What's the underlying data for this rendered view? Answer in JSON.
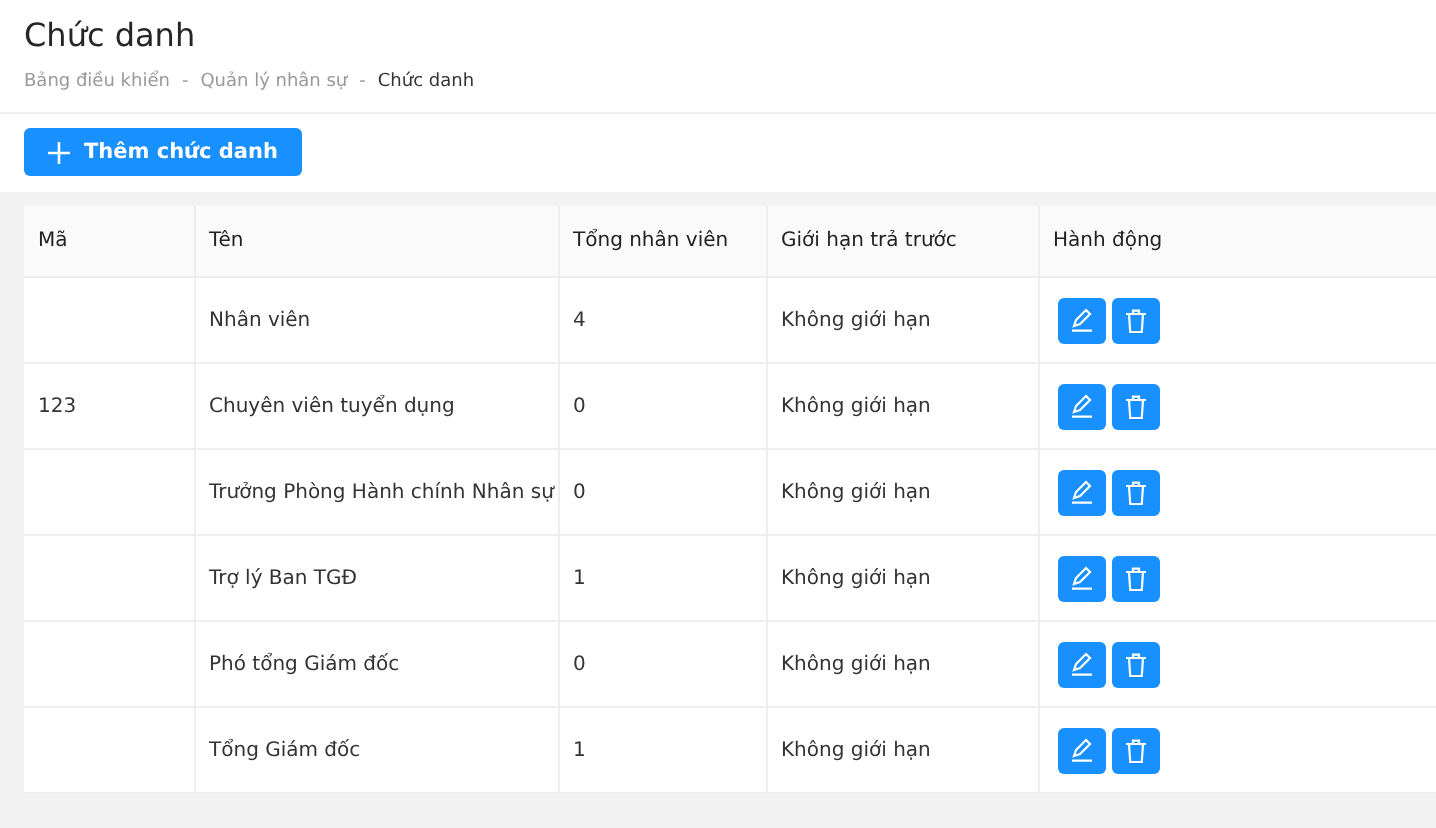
{
  "page_title": "Chức danh",
  "breadcrumb": [
    {
      "label": "Bảng điều khiển",
      "current": false
    },
    {
      "label": "Quản lý nhân sự",
      "current": false
    },
    {
      "label": "Chức danh",
      "current": true
    }
  ],
  "breadcrumb_separator": "-",
  "add_button": "Thêm chức danh",
  "table": {
    "columns": [
      "Mã",
      "Tên",
      "Tổng nhân viên",
      "Giới hạn trả trước",
      "Hành động"
    ],
    "rows": [
      {
        "code": "",
        "name": "Nhân viên",
        "total": "4",
        "limit": "Không giới hạn"
      },
      {
        "code": "123",
        "name": "Chuyên viên tuyển dụng",
        "total": "0",
        "limit": "Không giới hạn"
      },
      {
        "code": "",
        "name": "Trưởng Phòng Hành chính Nhân sự",
        "total": "0",
        "limit": "Không giới hạn"
      },
      {
        "code": "",
        "name": "Trợ lý Ban TGĐ",
        "total": "1",
        "limit": "Không giới hạn"
      },
      {
        "code": "",
        "name": "Phó tổng Giám đốc",
        "total": "0",
        "limit": "Không giới hạn"
      },
      {
        "code": "",
        "name": "Tổng Giám đốc",
        "total": "1",
        "limit": "Không giới hạn"
      }
    ]
  }
}
